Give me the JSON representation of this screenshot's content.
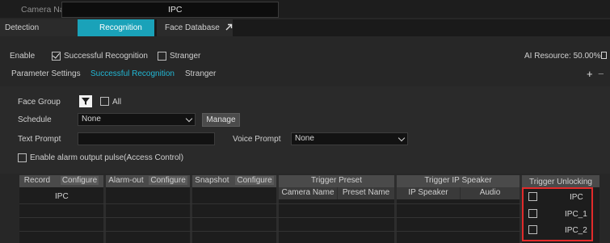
{
  "camera": {
    "label": "Camera Name",
    "value": "IPC"
  },
  "tabs": [
    {
      "label": "Detection"
    },
    {
      "label": "Recognition"
    },
    {
      "label": "Face Database",
      "icon": "arrow-up-right-icon"
    }
  ],
  "enable": {
    "label": "Enable",
    "successful": {
      "label": "Successful Recognition",
      "checked": true
    },
    "stranger": {
      "label": "Stranger",
      "checked": false
    },
    "ai_resource": "AI Resource: 50.00%"
  },
  "subtabs": [
    {
      "label": "Parameter Settings"
    },
    {
      "label": "Successful Recognition"
    },
    {
      "label": "Stranger"
    }
  ],
  "form": {
    "face_group": {
      "label": "Face Group",
      "all_label": "All"
    },
    "schedule": {
      "label": "Schedule",
      "value": "None",
      "manage": "Manage"
    },
    "text_prompt": {
      "label": "Text Prompt",
      "value": ""
    },
    "voice_prompt": {
      "label": "Voice Prompt",
      "value": "None"
    },
    "alarm_pulse": {
      "label": "Enable alarm output pulse(Access Control)",
      "checked": false
    }
  },
  "table": {
    "record": {
      "label": "Record",
      "configure": "Configure"
    },
    "alarm_out": {
      "label": "Alarm-out",
      "configure": "Configure"
    },
    "snapshot": {
      "label": "Snapshot",
      "configure": "Configure"
    },
    "trigger_preset": {
      "label": "Trigger Preset",
      "camera_name": "Camera Name",
      "preset_name": "Preset Name"
    },
    "trigger_speaker": {
      "label": "Trigger IP Speaker",
      "ip_speaker": "IP Speaker",
      "audio": "Audio"
    },
    "trigger_unlocking": {
      "label": "Trigger Unlocking",
      "items": [
        "IPC",
        "IPC_1",
        "IPC_2"
      ]
    },
    "record_rows": [
      "IPC"
    ]
  },
  "colors": {
    "accent": "#1aa2b9",
    "active_text": "#22b7d4",
    "highlight": "#e12a2a"
  }
}
